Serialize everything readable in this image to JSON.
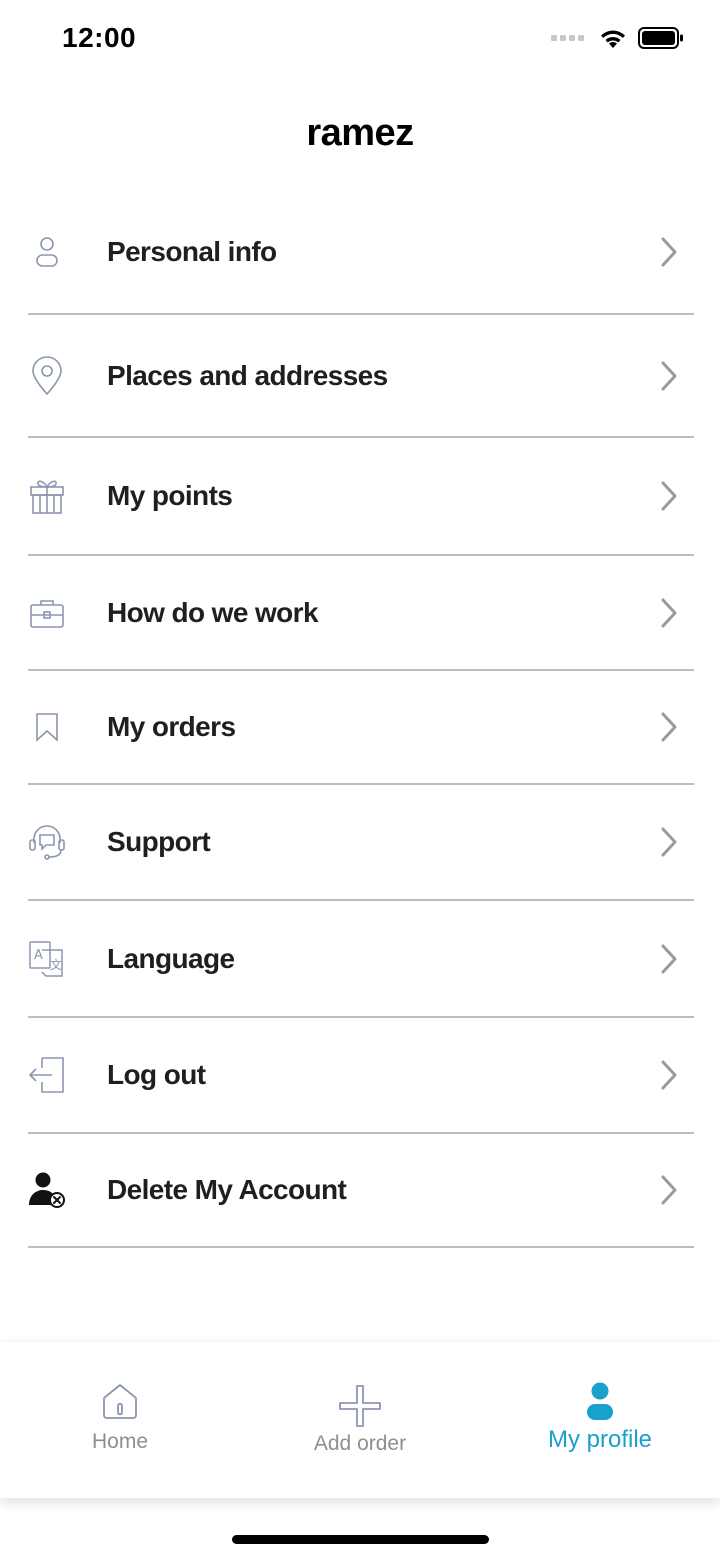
{
  "status_bar": {
    "time": "12:00"
  },
  "header": {
    "title": "ramez"
  },
  "menu": {
    "items": [
      {
        "label": "Personal info",
        "icon": "person-icon"
      },
      {
        "label": "Places and addresses",
        "icon": "location-pin-icon"
      },
      {
        "label": "My points",
        "icon": "gift-icon"
      },
      {
        "label": "How do we work",
        "icon": "briefcase-icon"
      },
      {
        "label": "My orders",
        "icon": "bookmark-icon"
      },
      {
        "label": "Support",
        "icon": "headset-chat-icon"
      },
      {
        "label": "Language",
        "icon": "translate-icon"
      },
      {
        "label": "Log out",
        "icon": "logout-icon"
      },
      {
        "label": "Delete My Account",
        "icon": "delete-user-icon"
      }
    ]
  },
  "tab_bar": {
    "tabs": [
      {
        "label": "Home",
        "icon": "home-icon"
      },
      {
        "label": "Add order",
        "icon": "plus-icon"
      },
      {
        "label": "My profile",
        "icon": "profile-icon"
      }
    ],
    "active_index": 2
  },
  "colors": {
    "accent": "#1aa0cc",
    "icon_outline": "#8a96b0",
    "divider": "#bdbdbd",
    "chevron": "#9a9a9a",
    "inactive_tab": "#8e8e93"
  }
}
